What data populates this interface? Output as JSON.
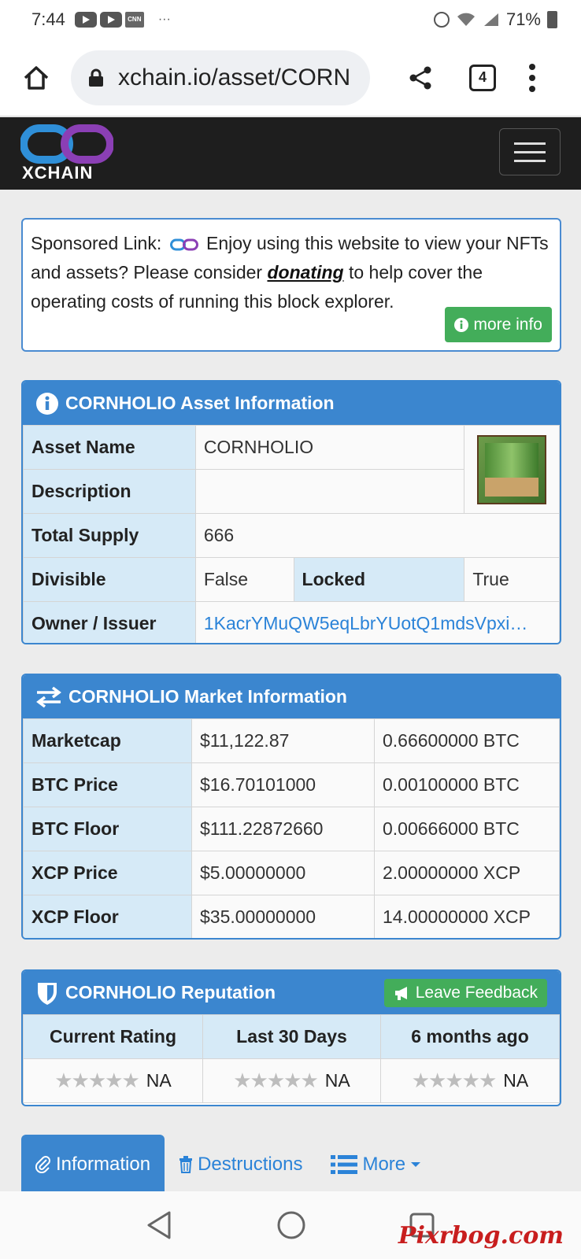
{
  "status_bar": {
    "time": "7:44",
    "battery": "71%",
    "dots": "···",
    "cnn_label": "CNN"
  },
  "browser": {
    "url": "xchain.io/asset/CORN",
    "tab_count": "4"
  },
  "site": {
    "logo_text": "XCHAIN"
  },
  "sponsored": {
    "prefix": "Sponsored Link:",
    "text_before": "Enjoy using this website to view your NFTs and assets? Please consider",
    "link": "donating",
    "text_after": "to help cover the operating costs of running this block explorer.",
    "button": "more info"
  },
  "asset_info": {
    "title": "CORNHOLIO Asset Information",
    "rows": {
      "asset_name_label": "Asset Name",
      "asset_name": "CORNHOLIO",
      "description_label": "Description",
      "description": "",
      "total_supply_label": "Total Supply",
      "total_supply": "666",
      "divisible_label": "Divisible",
      "divisible": "False",
      "locked_label": "Locked",
      "locked": "True",
      "owner_label": "Owner / Issuer",
      "owner": "1KacrYMuQW5eqLbrYUotQ1mdsVpxi…"
    }
  },
  "market_info": {
    "title": "CORNHOLIO Market Information",
    "rows": [
      {
        "label": "Marketcap",
        "usd": "$11,122.87",
        "native": "0.66600000 BTC"
      },
      {
        "label": "BTC Price",
        "usd": "$16.70101000",
        "native": "0.00100000 BTC"
      },
      {
        "label": "BTC Floor",
        "usd": "$111.22872660",
        "native": "0.00666000 BTC"
      },
      {
        "label": "XCP Price",
        "usd": "$5.00000000",
        "native": "2.00000000 XCP"
      },
      {
        "label": "XCP Floor",
        "usd": "$35.00000000",
        "native": "14.00000000 XCP"
      }
    ]
  },
  "reputation": {
    "title": "CORNHOLIO Reputation",
    "button": "Leave Feedback",
    "columns": [
      "Current Rating",
      "Last 30 Days",
      "6 months ago"
    ],
    "values": [
      "NA",
      "NA",
      "NA"
    ],
    "stars": "★★★★★"
  },
  "tabs": {
    "information": "Information",
    "destructions": "Destructions",
    "more": "More"
  },
  "watermark": "Pixrbog.com"
}
